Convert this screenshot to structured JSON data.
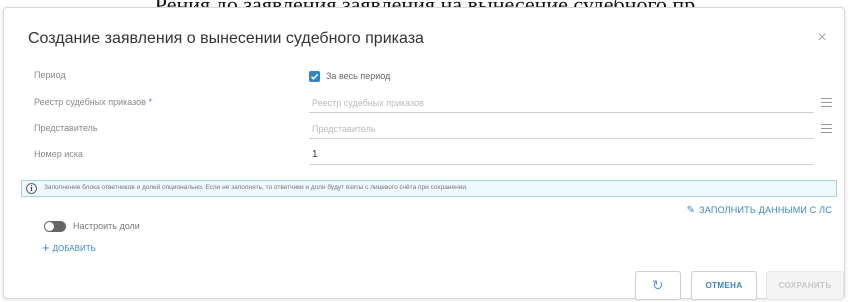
{
  "background_caption": "Рения до заявления заявления на вынесение судебного пр",
  "dialog": {
    "title": "Создание заявления о вынесении судебного приказа",
    "close_icon": "×"
  },
  "form": {
    "period": {
      "label": "Период",
      "checkbox_label": "За весь период",
      "checked": true
    },
    "registry": {
      "label": "Реестр судебных приказов",
      "required_mark": "*",
      "placeholder": "Реестр судебных приказов"
    },
    "representative": {
      "label": "Представитель",
      "placeholder": "Представитель"
    },
    "claim_number": {
      "label": "Номер иска",
      "value": "1"
    }
  },
  "info": {
    "icon": "info-icon",
    "text": "Заполнение блока ответчиков и долей опционально. Если не заполнять, то ответчики и доли будут взяты с лицевого счёта при сохранении."
  },
  "fill_link": "Заполнить данными с ЛС",
  "shares_toggle": {
    "label": "Настроить доли",
    "on": false
  },
  "add_link": "Добавить",
  "buttons": {
    "refresh_icon": "↻",
    "cancel": "Отмена",
    "save": "Сохранить"
  },
  "colors": {
    "accent": "#3b86c4",
    "checkbox": "#2f86c8",
    "info_bg": "#eef8fd",
    "info_border": "#9fd5ec",
    "required": "#d9534f"
  }
}
